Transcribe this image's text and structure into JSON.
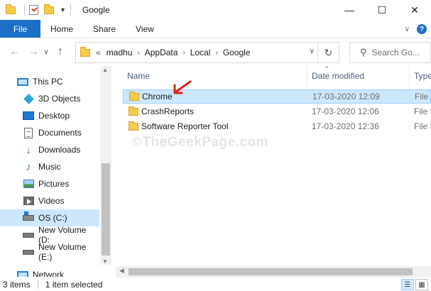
{
  "window": {
    "title": "Google",
    "minimize_glyph": "—",
    "maximize_glyph": "☐",
    "close_glyph": "✕"
  },
  "ribbon": {
    "tabs": [
      "File",
      "Home",
      "Share",
      "View"
    ],
    "expand_glyph": "∨",
    "help_glyph": "?"
  },
  "address": {
    "back_glyph": "←",
    "forward_glyph": "→",
    "recent_glyph": "∨",
    "up_glyph": "↑",
    "overflow": "«",
    "crumbs": [
      "madhu",
      "AppData",
      "Local",
      "Google"
    ],
    "crumb_separator": "›",
    "dropdown_glyph": "∨",
    "refresh_glyph": "↻"
  },
  "search": {
    "placeholder": "Search Go...",
    "icon": "search-icon"
  },
  "navpane": {
    "items": [
      {
        "label": "This PC",
        "icon": "this-pc-icon"
      },
      {
        "label": "3D Objects",
        "icon": "3d-objects-icon"
      },
      {
        "label": "Desktop",
        "icon": "desktop-icon"
      },
      {
        "label": "Documents",
        "icon": "documents-icon"
      },
      {
        "label": "Downloads",
        "icon": "downloads-icon"
      },
      {
        "label": "Music",
        "icon": "music-icon"
      },
      {
        "label": "Pictures",
        "icon": "pictures-icon"
      },
      {
        "label": "Videos",
        "icon": "videos-icon"
      },
      {
        "label": "OS (C:)",
        "icon": "drive-c-icon",
        "selected": true
      },
      {
        "label": "New Volume (D:",
        "icon": "drive-icon"
      },
      {
        "label": "New Volume (E:)",
        "icon": "drive-icon"
      },
      {
        "label": "Network",
        "icon": "network-icon"
      }
    ],
    "scroll_up_glyph": "▲",
    "scroll_down_glyph": "▼"
  },
  "filelist": {
    "columns": {
      "name": "Name",
      "date": "Date modified",
      "type": "Type"
    },
    "sort_glyph": "^",
    "rows": [
      {
        "name": "Chrome",
        "date": "17-03-2020 12:09",
        "type": "File fo",
        "selected": true
      },
      {
        "name": "CrashReports",
        "date": "17-03-2020 12:06",
        "type": "File fo",
        "selected": false
      },
      {
        "name": "Software Reporter Tool",
        "date": "17-03-2020 12:36",
        "type": "File fo",
        "selected": false
      }
    ],
    "hscroll_left_glyph": "◀"
  },
  "watermark": "©TheGeekPage.com",
  "status": {
    "item_count": "3 items",
    "selection": "1 item selected",
    "details_view_glyph": "☰",
    "tiles_view_glyph": "▦"
  },
  "colors": {
    "accent": "#1e6fc6",
    "selection": "#cce8ff",
    "folder": "#f6c94a",
    "annotation_arrow": "#e0201b"
  }
}
